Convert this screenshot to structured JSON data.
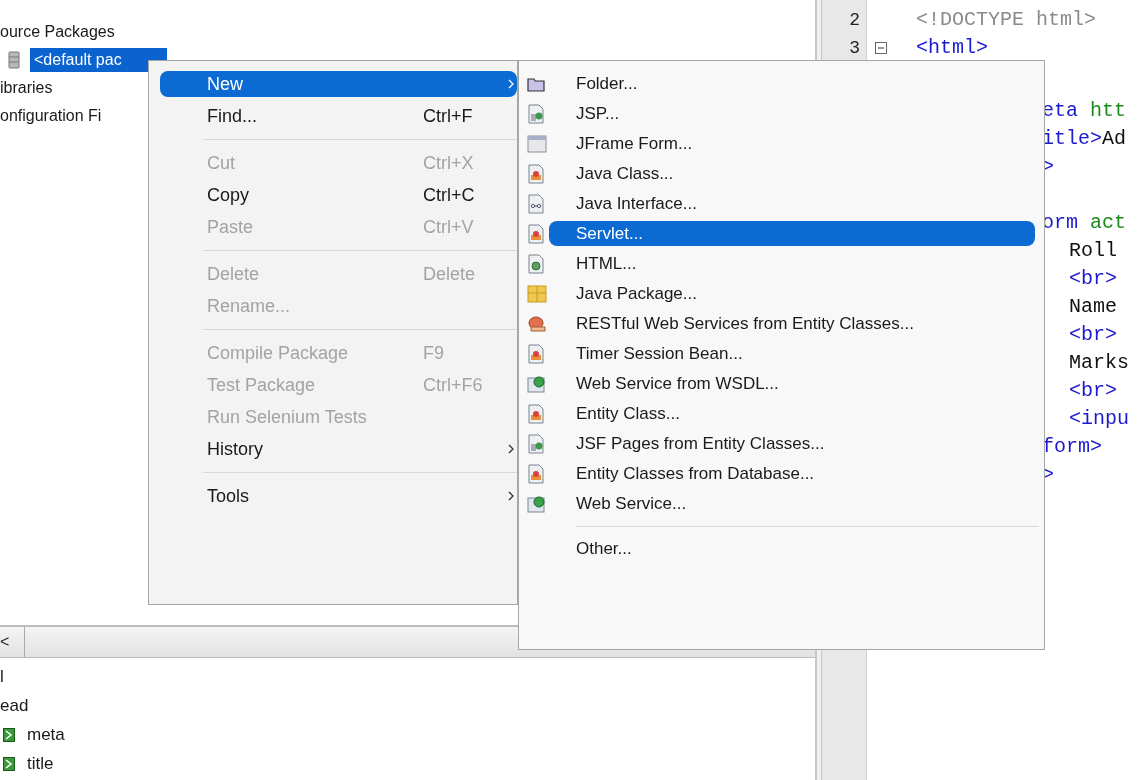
{
  "project_tree": {
    "items": [
      {
        "label": "ource Packages",
        "kind": "node",
        "selected": false
      },
      {
        "label": "<default pac",
        "kind": "package",
        "selected": true
      },
      {
        "label": "ibraries",
        "kind": "node",
        "selected": false
      },
      {
        "label": "onfiguration Fi",
        "kind": "node",
        "selected": false
      }
    ]
  },
  "navigator": {
    "scroll_button": "<",
    "items": [
      {
        "label": "l",
        "kind": "node"
      },
      {
        "label": "ead",
        "kind": "node"
      },
      {
        "label": "meta",
        "kind": "element"
      },
      {
        "label": "title",
        "kind": "element"
      }
    ]
  },
  "editor": {
    "lines": [
      {
        "number": "2",
        "foldable": false,
        "tokens": [
          {
            "text": "<!DOCTYPE html>",
            "kind": "doctype"
          }
        ]
      },
      {
        "number": "3",
        "foldable": true,
        "tokens": [
          {
            "text": "<html>",
            "kind": "tag"
          }
        ]
      }
    ],
    "clipped_blocks": [
      [
        {
          "tokens": [
            {
              "text": "eta",
              "kind": "tag"
            },
            {
              "text": " htt",
              "kind": "attr"
            }
          ]
        },
        {
          "tokens": [
            {
              "text": "itle>",
              "kind": "tag"
            },
            {
              "text": "Ad",
              "kind": "text"
            }
          ]
        },
        {
          "tokens": [
            {
              "text": ">",
              "kind": "tag"
            }
          ]
        }
      ],
      [
        {
          "tokens": [
            {
              "text": "orm",
              "kind": "tag"
            },
            {
              "text": " act",
              "kind": "attr"
            }
          ],
          "children": [
            {
              "tokens": [
                {
                  "text": "Roll",
                  "kind": "text"
                }
              ]
            },
            {
              "tokens": [
                {
                  "text": "<br>",
                  "kind": "tag"
                }
              ]
            },
            {
              "tokens": [
                {
                  "text": "Name",
                  "kind": "text"
                }
              ]
            },
            {
              "tokens": [
                {
                  "text": "<br>",
                  "kind": "tag"
                }
              ]
            },
            {
              "tokens": [
                {
                  "text": "Marks",
                  "kind": "text"
                }
              ]
            },
            {
              "tokens": [
                {
                  "text": "<br>",
                  "kind": "tag"
                }
              ]
            },
            {
              "tokens": [
                {
                  "text": "<inpu",
                  "kind": "tag"
                }
              ]
            }
          ]
        },
        {
          "tokens": [
            {
              "text": "form>",
              "kind": "tag"
            }
          ]
        },
        {
          "tokens": [
            {
              "text": ">",
              "kind": "tag"
            }
          ]
        }
      ]
    ]
  },
  "context_menu": {
    "groups": [
      [
        {
          "label": "New",
          "submenu": true,
          "disabled": false,
          "selected": true
        },
        {
          "label": "Find...",
          "shortcut": "Ctrl+F",
          "submenu": false,
          "disabled": false,
          "selected": false
        }
      ],
      [
        {
          "label": "Cut",
          "shortcut": "Ctrl+X",
          "submenu": false,
          "disabled": true,
          "selected": false
        },
        {
          "label": "Copy",
          "shortcut": "Ctrl+C",
          "submenu": false,
          "disabled": false,
          "selected": false
        },
        {
          "label": "Paste",
          "shortcut": "Ctrl+V",
          "submenu": false,
          "disabled": true,
          "selected": false
        }
      ],
      [
        {
          "label": "Delete",
          "shortcut": "Delete",
          "submenu": false,
          "disabled": true,
          "selected": false
        },
        {
          "label": "Rename...",
          "submenu": false,
          "disabled": true,
          "selected": false
        }
      ],
      [
        {
          "label": "Compile Package",
          "shortcut": "F9",
          "submenu": false,
          "disabled": true,
          "selected": false
        },
        {
          "label": "Test Package",
          "shortcut": "Ctrl+F6",
          "submenu": false,
          "disabled": true,
          "selected": false
        },
        {
          "label": "Run Selenium Tests",
          "submenu": false,
          "disabled": true,
          "selected": false
        },
        {
          "label": "History",
          "submenu": true,
          "disabled": false,
          "selected": false
        }
      ],
      [
        {
          "label": "Tools",
          "submenu": true,
          "disabled": false,
          "selected": false
        }
      ]
    ]
  },
  "new_submenu": {
    "groups": [
      [
        {
          "label": "Folder...",
          "kind": "folder",
          "selected": false
        },
        {
          "label": "JSP...",
          "kind": "page",
          "selected": false
        },
        {
          "label": "JFrame Form...",
          "kind": "window",
          "selected": false
        },
        {
          "label": "Java Class...",
          "kind": "class",
          "selected": false
        },
        {
          "label": "Java Interface...",
          "kind": "interface",
          "selected": false
        },
        {
          "label": "Servlet...",
          "kind": "class",
          "selected": true
        },
        {
          "label": "HTML...",
          "kind": "html",
          "selected": false
        },
        {
          "label": "Java Package...",
          "kind": "package",
          "selected": false
        },
        {
          "label": "RESTful Web Services from Entity Classes...",
          "kind": "rest",
          "selected": false
        },
        {
          "label": "Timer Session Bean...",
          "kind": "class",
          "selected": false
        },
        {
          "label": "Web Service from WSDL...",
          "kind": "service",
          "selected": false
        },
        {
          "label": "Entity Class...",
          "kind": "class",
          "selected": false
        },
        {
          "label": "JSF Pages from Entity Classes...",
          "kind": "page",
          "selected": false
        },
        {
          "label": "Entity Classes from Database...",
          "kind": "class",
          "selected": false
        },
        {
          "label": "Web Service...",
          "kind": "service",
          "selected": false
        }
      ],
      [
        {
          "label": "Other...",
          "kind": "none",
          "selected": false
        }
      ]
    ]
  }
}
